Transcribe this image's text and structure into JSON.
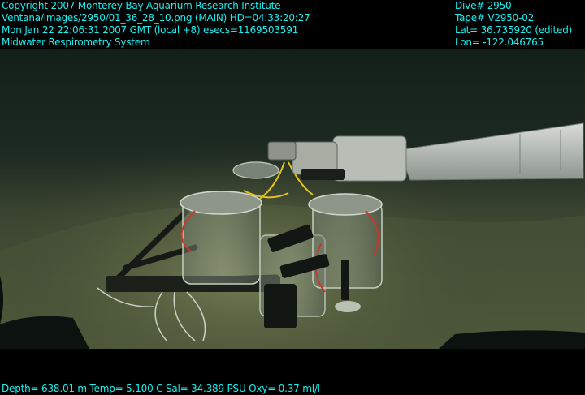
{
  "header": {
    "lines_left": [
      "Copyright 2007 Monterey Bay Aquarium Research Institute",
      "Ventana/images/2950/01_36_28_10.png (MAIN)  HD=04:33:20:27",
      "Mon Jan 22 22:06:31 2007 GMT (local +8)  esecs=1169503591",
      "Midwater Respirometry System"
    ],
    "lines_right": [
      "Dive# 2950",
      "Tape# V2950-02",
      "Lat= 36.735920 (edited)",
      "Lon= -122.046765"
    ]
  },
  "footer": {
    "telemetry": "Depth= 638.01 m  Temp= 5.100 C  Sal= 34.389 PSU  Oxy= 0.37 ml/l"
  },
  "colors": {
    "overlay_text": "#19f0f0",
    "background": "#000000",
    "water": "#1d2a22",
    "seafloor": "#4a5437"
  }
}
